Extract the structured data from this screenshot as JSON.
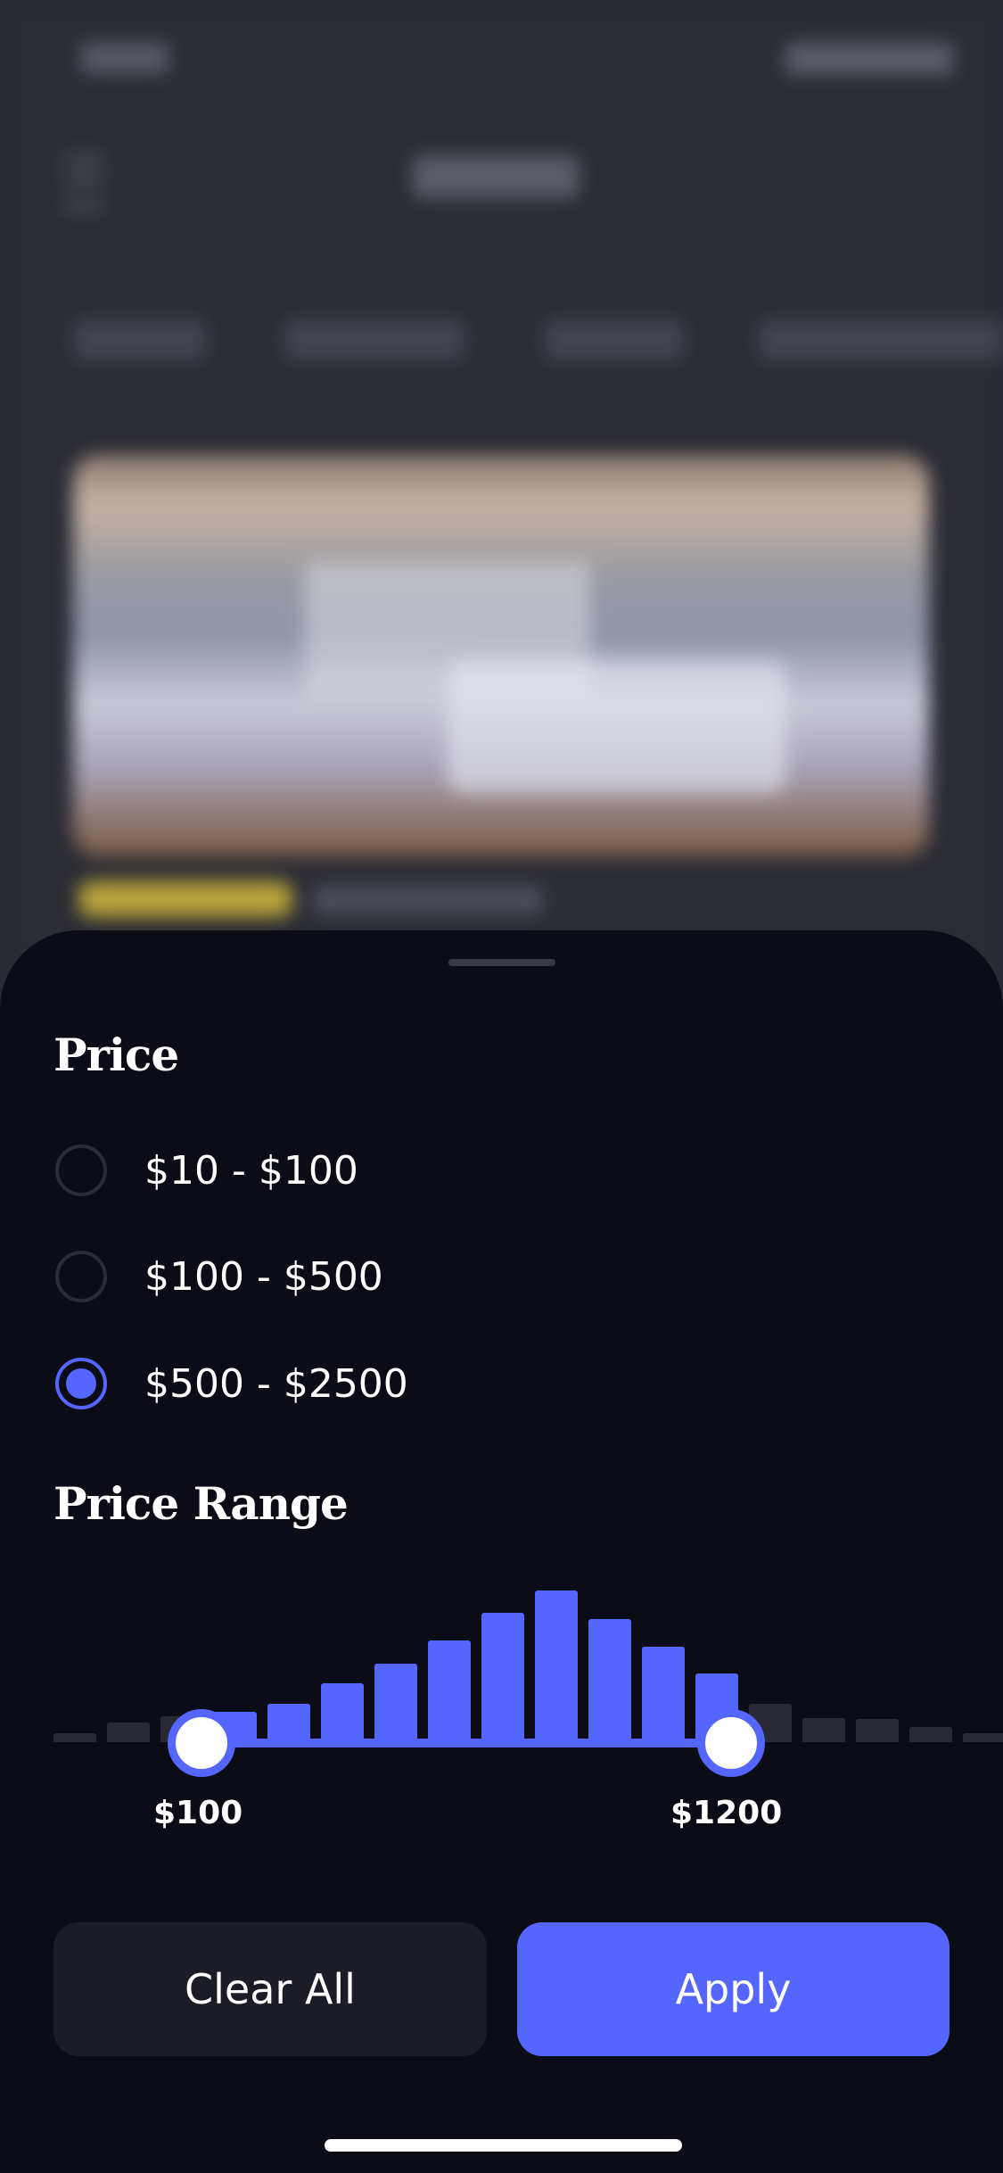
{
  "price": {
    "title": "Price",
    "options": [
      {
        "label": "$10 - $100",
        "selected": false
      },
      {
        "label": "$100 - $500",
        "selected": false
      },
      {
        "label": "$500 - $2500",
        "selected": true
      }
    ]
  },
  "price_range": {
    "title": "Price Range",
    "min_label": "$100",
    "max_label": "$1200",
    "histogram_levels": [
      0.06,
      0.13,
      0.17,
      0.2,
      0.25,
      0.39,
      0.52,
      0.67,
      0.85,
      1.0,
      0.81,
      0.63,
      0.45,
      0.25,
      0.16,
      0.15,
      0.1,
      0.06
    ],
    "selected_bar_range": [
      3,
      12
    ],
    "accent_color": "#5566ff",
    "inactive_bar_color": "#2a2a36"
  },
  "actions": {
    "clear_label": "Clear All",
    "apply_label": "Apply"
  }
}
